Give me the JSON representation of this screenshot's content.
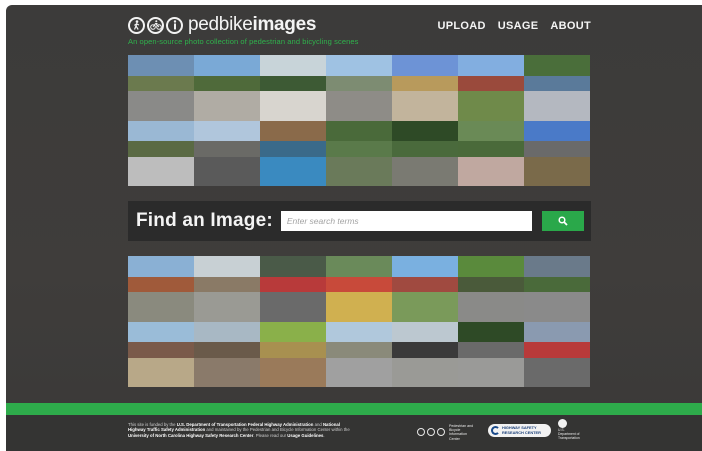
{
  "header": {
    "logo_text_light": "pedbike",
    "logo_text_bold": "images",
    "logo_icons": [
      "pedestrian-icon",
      "bicycle-icon",
      "info-icon"
    ],
    "tagline": "An open-source photo collection of pedestrian and bicycling scenes"
  },
  "nav": {
    "upload": "UPLOAD",
    "usage": "USAGE",
    "about": "ABOUT"
  },
  "search": {
    "label": "Find an Image:",
    "placeholder": "Enter search terms",
    "button_icon": "search-icon"
  },
  "photos_top": [
    {
      "sky": "#6d8fb3",
      "mid": "#6b7a4e",
      "ground": "#8a8a88"
    },
    {
      "sky": "#7aa9d6",
      "mid": "#4f6a3a",
      "ground": "#b0aca4"
    },
    {
      "sky": "#c8d4d9",
      "mid": "#3d5a34",
      "ground": "#d8d5cf"
    },
    {
      "sky": "#9fc2e3",
      "mid": "#7d8c72",
      "ground": "#8e8c87"
    },
    {
      "sky": "#6d93d6",
      "mid": "#b89a5c",
      "ground": "#c2b49c"
    },
    {
      "sky": "#82aee0",
      "mid": "#9a4a3c",
      "ground": "#6f8a4a"
    },
    {
      "sky": "#4a6e3a",
      "mid": "#5a7a9a",
      "ground": "#b4b8c0"
    },
    {
      "sky": "#9ab8d4",
      "mid": "#5a6a44",
      "ground": "#bdbdbd"
    },
    {
      "sky": "#b0c6dc",
      "mid": "#6a6a66",
      "ground": "#5a5a5a"
    },
    {
      "sky": "#8a6a4a",
      "mid": "#3a6a8a",
      "ground": "#3a8ac0"
    },
    {
      "sky": "#4a6a3a",
      "mid": "#5a7a4a",
      "ground": "#6a7a5a"
    },
    {
      "sky": "#2e4a26",
      "mid": "#4a6a3c",
      "ground": "#7a7a72"
    },
    {
      "sky": "#6a8a56",
      "mid": "#4a6a3a",
      "ground": "#c0a8a0"
    },
    {
      "sky": "#4a7ac8",
      "mid": "#6a6a6a",
      "ground": "#7a6a4a"
    }
  ],
  "photos_bottom": [
    {
      "sky": "#8ab0d4",
      "mid": "#a05a3a",
      "ground": "#8a8a7e"
    },
    {
      "sky": "#c8d0d4",
      "mid": "#8a7a66",
      "ground": "#9a9a94"
    },
    {
      "sky": "#4a5a48",
      "mid": "#b83a3a",
      "ground": "#6a6a6a"
    },
    {
      "sky": "#6a8a5a",
      "mid": "#c84a3a",
      "ground": "#d0b050"
    },
    {
      "sky": "#7ab0e0",
      "mid": "#a04a40",
      "ground": "#7a9a5a"
    },
    {
      "sky": "#5a8a3c",
      "mid": "#4a5a3a",
      "ground": "#8a8a88"
    },
    {
      "sky": "#6a7a8a",
      "mid": "#4a6a3a",
      "ground": "#8a8a8a"
    },
    {
      "sky": "#9abcd8",
      "mid": "#7a5a4a",
      "ground": "#b8a888"
    },
    {
      "sky": "#a8b8c4",
      "mid": "#6a5a4a",
      "ground": "#8a7a6a"
    },
    {
      "sky": "#8ab04a",
      "mid": "#a89050",
      "ground": "#9a7a5a"
    },
    {
      "sky": "#b0c8dc",
      "mid": "#8a8a7a",
      "ground": "#a0a0a0"
    },
    {
      "sky": "#bcc8d0",
      "mid": "#3a3a3a",
      "ground": "#9a9a96"
    },
    {
      "sky": "#2e4a26",
      "mid": "#6a6a6a",
      "ground": "#9a9a98"
    },
    {
      "sky": "#8a9ab0",
      "mid": "#b83a3a",
      "ground": "#6a6a6a"
    }
  ],
  "footer": {
    "text_1": "This site is funded by the ",
    "text_2": "U.S. Department of Transportation Federal Highway Administration",
    "text_3": " and ",
    "text_4": "National Highway Traffic Safety Administration",
    "text_5": " and maintained by the Pedestrian and Bicycle Information Center within the ",
    "text_6": "University of North Carolina Highway Safety Research Center",
    "text_7": ". Please read our ",
    "text_8": "Usage Guidelines",
    "text_9": ".",
    "pbic_label": "Pedestrian and Bicycle Information Center",
    "hsrc_label": "HIGHWAY SAFETY RESEARCH CENTER",
    "usdot_label": "U.S. Department of Transportation"
  },
  "colors": {
    "background": "#3c3b3a",
    "accent_green": "#2eab4b",
    "search_bar": "#2b2b2b"
  }
}
